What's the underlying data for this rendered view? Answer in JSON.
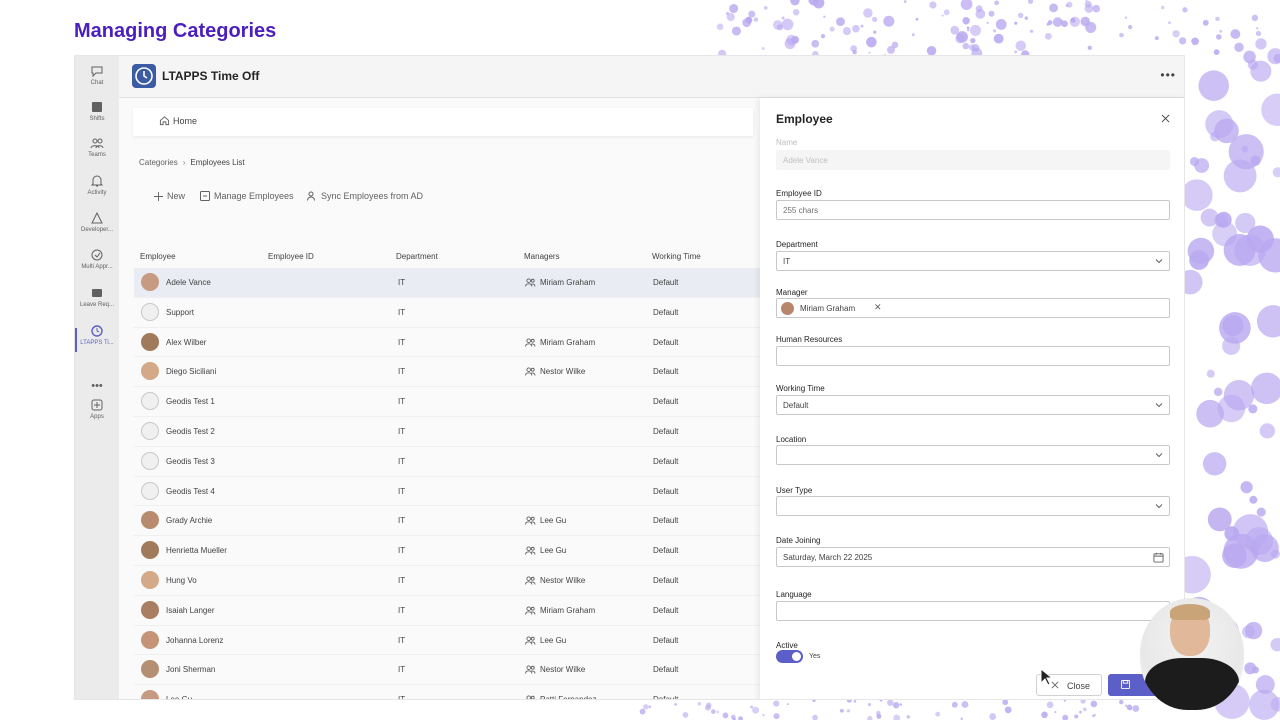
{
  "slide_title": "Managing Categories",
  "app": {
    "name": "LTAPPS Time Off",
    "more": "•••"
  },
  "rail": [
    {
      "label": "Chat",
      "icon": "chat-icon"
    },
    {
      "label": "Shifts",
      "icon": "shifts-icon"
    },
    {
      "label": "Teams",
      "icon": "teams-icon"
    },
    {
      "label": "Activity",
      "icon": "bell-icon"
    },
    {
      "label": "Developer...",
      "icon": "developer-icon"
    },
    {
      "label": "Multi Appr...",
      "icon": "approvals-icon"
    },
    {
      "label": "Leave Req...",
      "icon": "leave-icon"
    },
    {
      "label": "LTAPPS Ti...",
      "icon": "clock-icon"
    },
    {
      "label": "•••",
      "icon": "more-icon"
    },
    {
      "label": "Apps",
      "icon": "apps-icon"
    }
  ],
  "home": {
    "label": "Home"
  },
  "breadcrumb": {
    "root": "Categories",
    "current": "Employees List"
  },
  "commands": {
    "new": "New",
    "manage": "Manage Employees",
    "sync": "Sync Employees from AD"
  },
  "columns": {
    "employee": "Employee",
    "employee_id": "Employee ID",
    "department": "Department",
    "managers": "Managers",
    "working_time": "Working Time"
  },
  "rows": [
    {
      "name": "Adele Vance",
      "dept": "IT",
      "manager": "Miriam Graham",
      "wt": "Default",
      "photo": true,
      "selected": true
    },
    {
      "name": "Support",
      "dept": "IT",
      "manager": "",
      "wt": "Default",
      "photo": false
    },
    {
      "name": "Alex Wilber",
      "dept": "IT",
      "manager": "Miriam Graham",
      "wt": "Default",
      "photo": true
    },
    {
      "name": "Diego Siciliani",
      "dept": "IT",
      "manager": "Nestor Wilke",
      "wt": "Default",
      "photo": true
    },
    {
      "name": "Geodis Test 1",
      "dept": "IT",
      "manager": "",
      "wt": "Default",
      "photo": false
    },
    {
      "name": "Geodis Test 2",
      "dept": "IT",
      "manager": "",
      "wt": "Default",
      "photo": false
    },
    {
      "name": "Geodis Test 3",
      "dept": "IT",
      "manager": "",
      "wt": "Default",
      "photo": false
    },
    {
      "name": "Geodis Test 4",
      "dept": "IT",
      "manager": "",
      "wt": "Default",
      "photo": false
    },
    {
      "name": "Grady Archie",
      "dept": "IT",
      "manager": "Lee Gu",
      "wt": "Default",
      "photo": true
    },
    {
      "name": "Henrietta Mueller",
      "dept": "IT",
      "manager": "Lee Gu",
      "wt": "Default",
      "photo": true
    },
    {
      "name": "Hung Vo",
      "dept": "IT",
      "manager": "Nestor Wilke",
      "wt": "Default",
      "photo": true
    },
    {
      "name": "Isaiah Langer",
      "dept": "IT",
      "manager": "Miriam Graham",
      "wt": "Default",
      "photo": true
    },
    {
      "name": "Johanna Lorenz",
      "dept": "IT",
      "manager": "Lee Gu",
      "wt": "Default",
      "photo": true
    },
    {
      "name": "Joni Sherman",
      "dept": "IT",
      "manager": "Nestor Wilke",
      "wt": "Default",
      "photo": true
    },
    {
      "name": "Lee Gu",
      "dept": "IT",
      "manager": "Patti Fernandez",
      "wt": "Default",
      "photo": true
    }
  ],
  "panel": {
    "title": "Employee",
    "name_label": "Name",
    "name_value": "Adele Vance",
    "employee_id_label": "Employee ID",
    "employee_id_placeholder": "255 chars",
    "department_label": "Department",
    "department_value": "IT",
    "manager_label": "Manager",
    "manager_value": "Miriam Graham",
    "manager_remove": "✕",
    "hr_label": "Human Resources",
    "working_time_label": "Working Time",
    "working_time_value": "Default",
    "location_label": "Location",
    "user_type_label": "User Type",
    "date_label": "Date Joining",
    "date_value": "Saturday, March 22 2025",
    "language_label": "Language",
    "active_label": "Active",
    "active_value": "Yes",
    "active": true,
    "close_label": "Close"
  },
  "colors": {
    "accent": "#5b5fc7",
    "title": "#4b1fbf",
    "dots": "#b9a8f0"
  }
}
